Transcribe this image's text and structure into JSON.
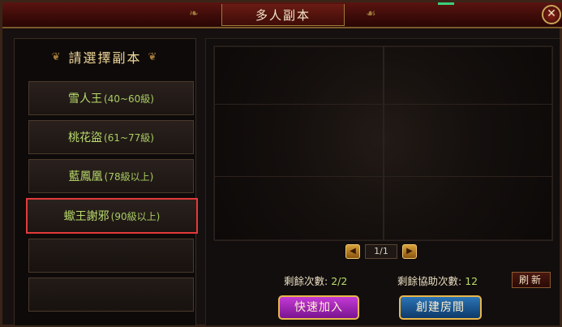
{
  "window": {
    "title": "多人副本"
  },
  "left_panel": {
    "header": "請選擇副本",
    "instances": [
      {
        "name": "雪人王",
        "level": "(40~60級)",
        "selected": false
      },
      {
        "name": "桃花盜",
        "level": "(61~77級)",
        "selected": false
      },
      {
        "name": "藍鳳凰",
        "level": "(78級以上)",
        "selected": false
      },
      {
        "name": "蠍王謝邪",
        "level": "(90級以上)",
        "selected": true
      }
    ]
  },
  "pager": {
    "text": "1/1",
    "prev_icon": "arrow-left-icon",
    "next_icon": "arrow-right-icon"
  },
  "stats": {
    "remaining_label": "剩餘次數:",
    "remaining_value": "2/2",
    "assist_label": "剩餘協助次數:",
    "assist_value": "12"
  },
  "buttons": {
    "refresh": "刷新",
    "quick_join": "快速加入",
    "create_room": "創建房間",
    "close_icon": "close-icon"
  },
  "colors": {
    "title_bar": "#3b0b08",
    "instance_text": "#b9dc6c",
    "selected_border": "#e23a3a",
    "join_button": "#a024b8",
    "create_button": "#1e5a94",
    "button_border": "#e8b64a"
  }
}
